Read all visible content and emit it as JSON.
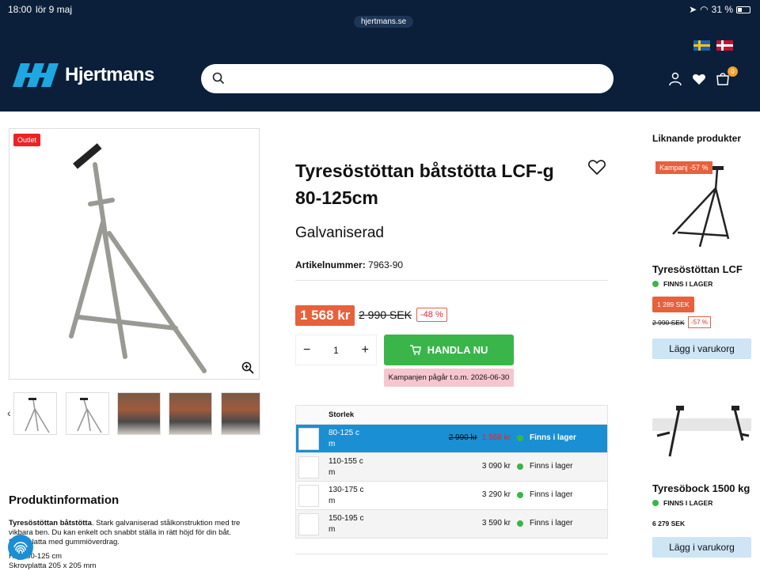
{
  "statusbar": {
    "time": "18:00",
    "date": "lör 9 maj",
    "url": "hjertmans.se",
    "battery": "31 %"
  },
  "header": {
    "logo_text": "Hjertmans",
    "search_placeholder": "",
    "cart_count": "0"
  },
  "product": {
    "badge": "Outlet",
    "title": "Tyresöstöttan båtstötta LCF-g 80-125cm",
    "subtitle": "Galvaniserad",
    "artnr_label": "Artikelnummer:",
    "artnr_value": "7963-90",
    "price": "1 568 kr",
    "old_price": "2 990 SEK",
    "discount": "-48 %",
    "qty_minus": "−",
    "qty_value": "1",
    "qty_plus": "+",
    "buy_label": "HANDLA NU",
    "campaign_text": "Kampanjen pågår t.o.m. 2026-06-30"
  },
  "variants": {
    "header": "Storlek",
    "rows": [
      {
        "size": "80-125 c m",
        "old": "2 990 kr",
        "price": "1 568 kr",
        "stock": "Finns i lager"
      },
      {
        "size": "110-155 c m",
        "price": "3 090 kr",
        "stock": "Finns i lager"
      },
      {
        "size": "130-175 c m",
        "price": "3 290 kr",
        "stock": "Finns i lager"
      },
      {
        "size": "150-195 c m",
        "price": "3 590 kr",
        "stock": "Finns i lager"
      }
    ]
  },
  "info": {
    "title": "Produktinformation",
    "lead": "Tyresöstöttan båtstötta",
    "text": ". Stark galvaniserad stålkonstruktion med tre vikbara ben. Du kan enkelt och snabbt ställa in rätt höjd för din båt. Skrovplatta med gummiöverdrag.",
    "spec1": "Höjd 80-125 cm",
    "spec2": "Skrovplatta 205 x 205 mm"
  },
  "similar": {
    "title": "Liknande produkter",
    "items": [
      {
        "badge": "Kampanj -57 %",
        "name": "Tyresöstöttan LCF",
        "stock": "FINNS I LAGER",
        "price": "1 289 SEK",
        "old": "2 990 SEK",
        "pct": "-57 %",
        "cta": "Lägg i varukorg"
      },
      {
        "name": "Tyresöbock 1500 kg",
        "stock": "FINNS I LAGER",
        "price": "6 279 SEK",
        "cta": "Lägg i varukorg"
      }
    ]
  },
  "colors": {
    "navy": "#0b1f3a",
    "green": "#3ab54a",
    "orange": "#e8603c",
    "blue": "#1b8fd3"
  }
}
